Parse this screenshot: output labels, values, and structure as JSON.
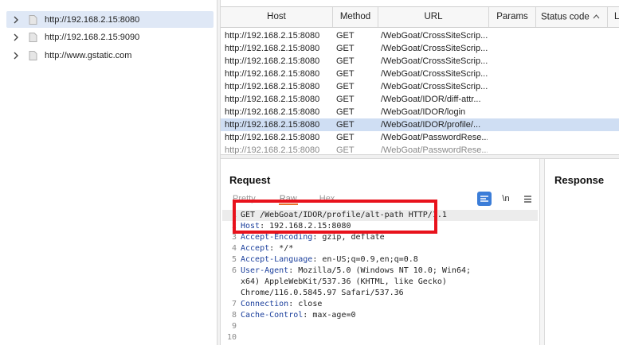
{
  "site_map": {
    "items": [
      {
        "label": "http://192.168.2.15:8080",
        "selected": true
      },
      {
        "label": "http://192.168.2.15:9090",
        "selected": false
      },
      {
        "label": "http://www.gstatic.com",
        "selected": false
      }
    ]
  },
  "history_table": {
    "columns": [
      "Host",
      "Method",
      "URL",
      "Params",
      "Status code",
      "L"
    ],
    "sort_column": "Status code",
    "rows": [
      {
        "host": "http://192.168.2.15:8080",
        "method": "GET",
        "url": "/WebGoat/CrossSiteScrip..."
      },
      {
        "host": "http://192.168.2.15:8080",
        "method": "GET",
        "url": "/WebGoat/CrossSiteScrip..."
      },
      {
        "host": "http://192.168.2.15:8080",
        "method": "GET",
        "url": "/WebGoat/CrossSiteScrip..."
      },
      {
        "host": "http://192.168.2.15:8080",
        "method": "GET",
        "url": "/WebGoat/CrossSiteScrip..."
      },
      {
        "host": "http://192.168.2.15:8080",
        "method": "GET",
        "url": "/WebGoat/CrossSiteScrip..."
      },
      {
        "host": "http://192.168.2.15:8080",
        "method": "GET",
        "url": "/WebGoat/IDOR/diff-attr..."
      },
      {
        "host": "http://192.168.2.15:8080",
        "method": "GET",
        "url": "/WebGoat/IDOR/login"
      },
      {
        "host": "http://192.168.2.15:8080",
        "method": "GET",
        "url": "/WebGoat/IDOR/profile/..."
      },
      {
        "host": "http://192.168.2.15:8080",
        "method": "GET",
        "url": "/WebGoat/PasswordRese..."
      },
      {
        "host": "http://192.168.2.15:8080",
        "method": "GET",
        "url": "/WebGoat/PasswordRese..."
      }
    ],
    "selected_row": 7
  },
  "request": {
    "title": "Request",
    "tabs": [
      "Pretty",
      "Raw",
      "Hex"
    ],
    "active_tab": "Raw",
    "newline_toggle": "\\n",
    "lines": [
      {
        "num": "1",
        "text": "GET /WebGoat/IDOR/profile/alt-path HTTP/1.1"
      },
      {
        "num": "2",
        "key": "Host",
        "value": " 192.168.2.15:8080"
      },
      {
        "num": "3",
        "key": "Accept-Encoding",
        "value": " gzip, deflate"
      },
      {
        "num": "4",
        "key": "Accept",
        "value": " */*"
      },
      {
        "num": "5",
        "key": "Accept-Language",
        "value": " en-US;q=0.9,en;q=0.8"
      },
      {
        "num": "6",
        "key": "User-Agent",
        "value": " Mozilla/5.0 (Windows NT 10.0; Win64;"
      },
      {
        "num": "",
        "text": "x64) AppleWebKit/537.36 (KHTML, like Gecko)"
      },
      {
        "num": "",
        "text": "Chrome/116.0.5845.97 Safari/537.36"
      },
      {
        "num": "7",
        "key": "Connection",
        "value": " close"
      },
      {
        "num": "8",
        "key": "Cache-Control",
        "value": " max-age=0"
      },
      {
        "num": "9",
        "text": ""
      },
      {
        "num": "10",
        "text": ""
      }
    ]
  },
  "response": {
    "title": "Response"
  },
  "colors": {
    "annotation": "#e8121c",
    "selected_row": "#cfdef3",
    "active_tab_underline": "#e8712a",
    "header_key": "#1b3f9c"
  }
}
